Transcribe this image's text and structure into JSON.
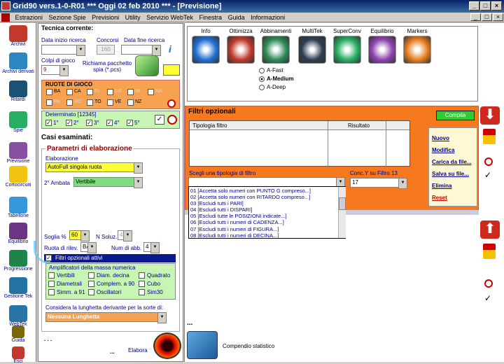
{
  "window": {
    "title": "Grid90 vers.1-0-R01  ***  Oggi 02 feb 2010  ***  - [Previsione]",
    "min": "_",
    "max": "□",
    "close": "×",
    "mdi_min": "_",
    "mdi_max": "□",
    "mdi_close": "×"
  },
  "menu": [
    "Estrazioni",
    "Sezione Spie",
    "Previsioni",
    "Utility",
    "Servizio WebTek",
    "Finestra",
    "Guida",
    "Informazioni"
  ],
  "toolbar": [
    {
      "label": "Archivi",
      "icon": "pencil-icon",
      "color": "#c0392b"
    },
    {
      "label": "Archivi derivati",
      "icon": "database-icon",
      "color": "#2e86c1"
    },
    {
      "label": "Ritardi",
      "icon": "clock-icon",
      "color": "#1a5276"
    },
    {
      "label": "Spie",
      "icon": "flashlight-icon",
      "color": "#27ae60"
    },
    {
      "label": "Previsione",
      "icon": "checklist-icon",
      "color": "#884ea0"
    },
    {
      "label": "Cortocircuiti",
      "icon": "bulb-icon",
      "color": "#f1c40f"
    },
    {
      "label": "Tabellone",
      "icon": "grid-icon",
      "color": "#3498db"
    },
    {
      "label": "Equilibrio",
      "icon": "scale-icon",
      "color": "#6c3483"
    },
    {
      "label": "Progressione",
      "icon": "dollar-icon",
      "color": "#1e8449"
    },
    {
      "label": "Gestione Tek",
      "icon": "tools-icon",
      "color": "#2471a3"
    },
    {
      "label": "WebTek",
      "icon": "globe-icon",
      "color": "#2874a6"
    },
    {
      "label": "Guida",
      "icon": "book-icon",
      "color": "#7d6608"
    },
    {
      "label": "Esci",
      "icon": "exit-icon",
      "color": "#c0392b"
    }
  ],
  "tecnica": {
    "title": "Tecnica corrente:",
    "data_inizio_label": "Data inizio ricerca",
    "concorsi_label": "Concorsi",
    "concorsi_value": "160",
    "data_fine_label": "Data fine ricerca",
    "colpi_label": "Colpi di gioco",
    "colpi_value": "9",
    "richiama_label": "Richiama pacchetto spia (*.pcs)",
    "info_icon": "i"
  },
  "ruote": {
    "title": "RUOTE DI GIOCO",
    "items": [
      {
        "code": "BA",
        "enabled": true
      },
      {
        "code": "CA",
        "enabled": true
      },
      {
        "code": "FI",
        "enabled": false
      },
      {
        "code": "GE",
        "enabled": false
      },
      {
        "code": "MI",
        "enabled": false
      },
      {
        "code": "NA",
        "enabled": false
      },
      {
        "code": "PA",
        "enabled": false
      },
      {
        "code": "RO",
        "enabled": false
      },
      {
        "code": "TO",
        "enabled": true
      },
      {
        "code": "VE",
        "enabled": true
      },
      {
        "code": "NZ",
        "enabled": true
      }
    ]
  },
  "determinato": {
    "title": "Determinato [12345]",
    "items": [
      "1°",
      "2°",
      "3°",
      "4°",
      "5°"
    ]
  },
  "casi": {
    "title": "Casi esaminati:",
    "params_title": "Parametri di elaborazione",
    "elaborazione_label": "Elaborazione",
    "elaborazione_value": "AutoFull singola ruota",
    "ambata_label": "2° Ambata",
    "ambata_value": "Vertibile",
    "soglia_label": "Soglia %",
    "soglia_value": "60",
    "nsoluz_label": "N Soluz.",
    "nsoluz_value": "4",
    "rilev_label": "Ruota di rilev.",
    "rilev_value": "BA",
    "numabb_label": "Num di abb.",
    "numabb_value": "4",
    "filtri_attivi_label": "Filtri opzionali attivi",
    "amplif_title": "Amplificatori della massa numerica",
    "amplif_items": [
      "Vertibili",
      "Diam. decina",
      "Quadrato",
      "Diametrali",
      "Complem. a 90",
      "Cubo",
      "Simm. a 91",
      "Oscillatori",
      "Sim30"
    ],
    "lunghetta_label": "Considera la lunghetta derivante per la sorte di:",
    "lunghetta_value": "Nessuna Lunghetta",
    "dots": ". . .",
    "dots2": "...",
    "elabora_label": "Elabora"
  },
  "icons_row": [
    {
      "label": "Info",
      "icon": "question-icon",
      "color": "#1f6fd1"
    },
    {
      "label": "Ottimizza",
      "icon": "flame-icon",
      "color": "#c0392b"
    },
    {
      "label": "Abbinamenti",
      "icon": "gear-icon",
      "color": "#2e8b57"
    },
    {
      "label": "MultiTek",
      "icon": "s-curve-icon",
      "color": "#2c3e50"
    },
    {
      "label": "SuperConv",
      "icon": "recycle-icon",
      "color": "#27ae60"
    },
    {
      "label": "Equilibrio",
      "icon": "bag-icon",
      "color": "#8e44ad"
    },
    {
      "label": "Markers",
      "icon": "fan-icon",
      "color": "#e67e22"
    }
  ],
  "modes": [
    {
      "label": "A-Fast",
      "selected": false
    },
    {
      "label": "A-Medium",
      "selected": true
    },
    {
      "label": "A-Deep",
      "selected": false
    }
  ],
  "filtri": {
    "title": "Filtri opzionali",
    "compila": "Compila",
    "col_tipologia": "Tipologia filtro",
    "col_risultato": "Risultato",
    "scegli_label": "Scegli una tipologia di filtro",
    "conc_label": "Conc.Y su Filtro 13",
    "conc_value": "17",
    "list": [
      "01 [Accetta solo numeri con PUNTO G compreso...]",
      "02 [Accetta solo numeri con RITARDO compreso...]",
      "03 [Escludi tutti i PARI]",
      "04 [Escludi tutti i DISPARI]",
      "05 [Escludi tutte le POSIZIONI indicate...]",
      "06 [Escludi tutti i numeri di CADENZA...]",
      "07 [Escludi tutti i numeri di FIGURA...]",
      "08 [Escludi tutti i numeri di DECINA...]"
    ],
    "actions": [
      "Nuovo",
      "Modifica",
      "Carica da file...",
      "Salva su file...",
      "Elimina",
      "Reset"
    ]
  },
  "bottom": {
    "dots": "...",
    "compendio_label": "Compendio statistico"
  }
}
